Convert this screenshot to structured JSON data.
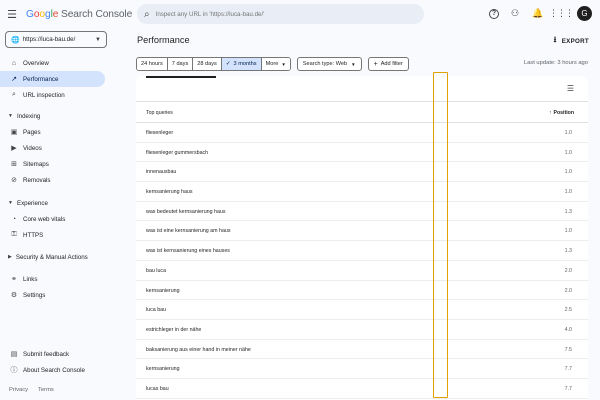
{
  "header": {
    "logo_google": [
      "G",
      "o",
      "o",
      "g",
      "l",
      "e"
    ],
    "logo_rest": " Search Console",
    "search_placeholder": "Inspect any URL in 'https://luca-bau.de/'",
    "avatar_letter": "G"
  },
  "sidebar": {
    "property": "https://luca-bau.de/",
    "items": [
      {
        "label": "Overview",
        "icon": "home-icon",
        "glyph": "⌂"
      },
      {
        "label": "Performance",
        "icon": "trending-up-icon",
        "glyph": "↗"
      },
      {
        "label": "URL inspection",
        "icon": "search-icon",
        "glyph": "⌕"
      }
    ],
    "sections": [
      {
        "label": "Indexing",
        "items": [
          {
            "label": "Pages",
            "icon": "pages-icon",
            "glyph": "▣"
          },
          {
            "label": "Videos",
            "icon": "video-icon",
            "glyph": "▶"
          },
          {
            "label": "Sitemaps",
            "icon": "sitemap-icon",
            "glyph": "⊞"
          },
          {
            "label": "Removals",
            "icon": "removals-icon",
            "glyph": "⊘"
          }
        ]
      },
      {
        "label": "Experience",
        "items": [
          {
            "label": "Core web vitals",
            "icon": "speed-icon",
            "glyph": "◔"
          },
          {
            "label": "HTTPS",
            "icon": "lock-icon",
            "glyph": "🔒"
          }
        ]
      },
      {
        "label": "Security & Manual Actions",
        "items": []
      }
    ],
    "bottom_items": [
      {
        "label": "Links",
        "icon": "links-icon",
        "glyph": "⚭"
      },
      {
        "label": "Settings",
        "icon": "gear-icon",
        "glyph": "⚙"
      }
    ],
    "footer_items": [
      {
        "label": "Submit feedback",
        "icon": "feedback-icon",
        "glyph": "▤"
      },
      {
        "label": "About Search Console",
        "icon": "info-icon",
        "glyph": "ⓘ"
      }
    ],
    "footer_links": [
      "Privacy",
      "Terms"
    ]
  },
  "main": {
    "title": "Performance",
    "export_label": "EXPORT",
    "date_ranges": [
      "24 hours",
      "7 days",
      "28 days",
      "3 months",
      "More"
    ],
    "selected_range": "3 months",
    "search_type": "Search type: Web",
    "add_filter": "Add filter",
    "last_update": "Last update: 3 hours ago",
    "table": {
      "col_query": "Top queries",
      "col_position": "Position",
      "rows": [
        {
          "query": "fliesenleger",
          "position": "1.0"
        },
        {
          "query": "fliesenleger gummersbach",
          "position": "1.0"
        },
        {
          "query": "innenausbau",
          "position": "1.0"
        },
        {
          "query": "kernsanierung haus",
          "position": "1.0"
        },
        {
          "query": "was bedeutet kernsanierung haus",
          "position": "1.3"
        },
        {
          "query": "was ist eine kernsanierung am haus",
          "position": "1.0"
        },
        {
          "query": "was ist kernsanierung eines hauses",
          "position": "1.3"
        },
        {
          "query": "bau luca",
          "position": "2.0"
        },
        {
          "query": "kernsanierung",
          "position": "2.0"
        },
        {
          "query": "luca bau",
          "position": "2.5"
        },
        {
          "query": "estrichleger in der nähe",
          "position": "4.0"
        },
        {
          "query": "baksanierung aus einer hand in meiner nähe",
          "position": "7.5"
        },
        {
          "query": "kernsanierung",
          "position": "7.7"
        },
        {
          "query": "lucas bau",
          "position": "7.7"
        }
      ]
    }
  }
}
